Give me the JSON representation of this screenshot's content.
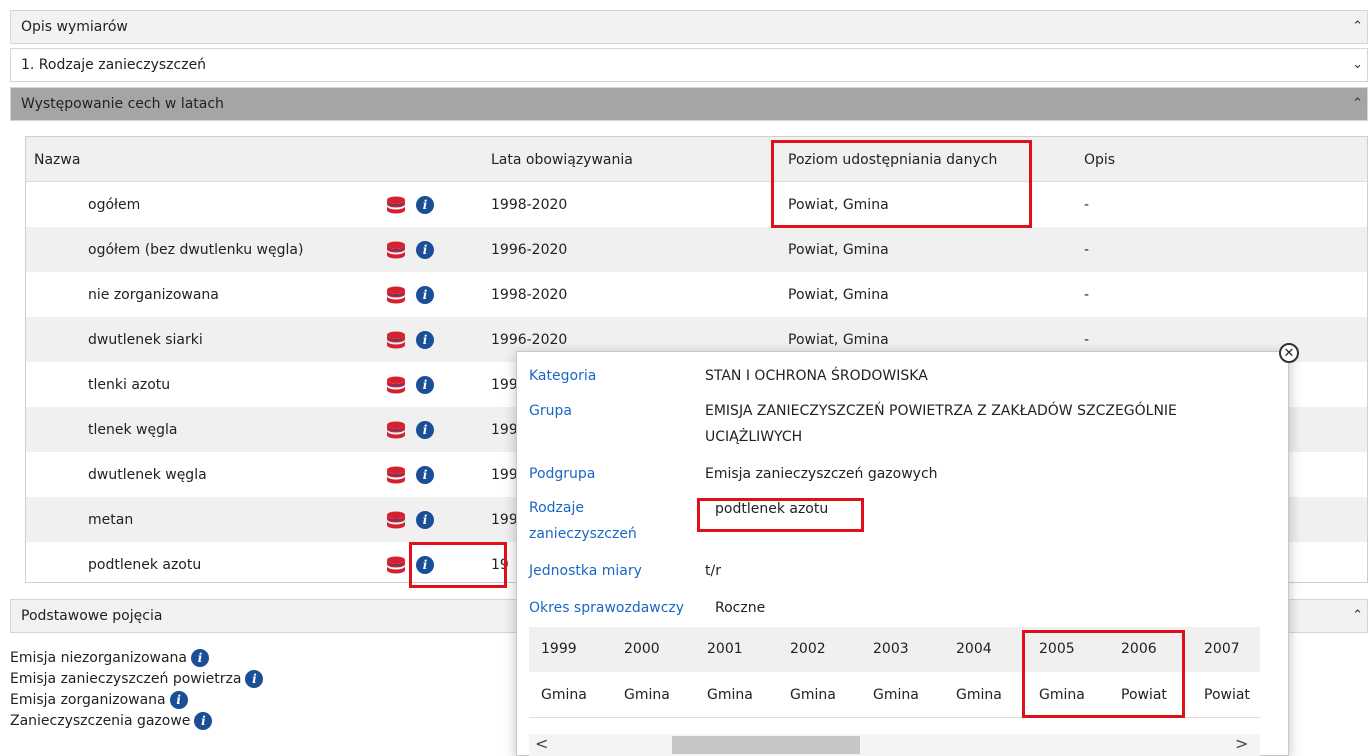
{
  "sections": {
    "dimensions_title": "Opis wymiarów",
    "dimension_item": "1. Rodzaje zanieczyszczeń",
    "years_title": "Występowanie cech w latach",
    "concepts_title": "Podstawowe pojęcia"
  },
  "table": {
    "headers": {
      "name": "Nazwa",
      "years": "Lata obowiązywania",
      "level": "Poziom udostępniania danych",
      "desc": "Opis"
    },
    "rows": [
      {
        "name": "ogółem",
        "years": "1998-2020",
        "level": "Powiat, Gmina",
        "desc": "-"
      },
      {
        "name": "ogółem (bez dwutlenku węgla)",
        "years": "1996-2020",
        "level": "Powiat, Gmina",
        "desc": "-"
      },
      {
        "name": "nie zorganizowana",
        "years": "1998-2020",
        "level": "Powiat, Gmina",
        "desc": "-"
      },
      {
        "name": "dwutlenek siarki",
        "years": "1996-2020",
        "level": "Powiat, Gmina",
        "desc": "-"
      },
      {
        "name": "tlenki azotu",
        "years": "199",
        "level": "",
        "desc": ""
      },
      {
        "name": "tlenek węgla",
        "years": "199",
        "level": "",
        "desc": ""
      },
      {
        "name": "dwutlenek węgla",
        "years": "199",
        "level": "",
        "desc": ""
      },
      {
        "name": "metan",
        "years": "199",
        "level": "",
        "desc": ""
      },
      {
        "name": "podtlenek azotu",
        "years": "19",
        "level": "",
        "desc": ""
      }
    ]
  },
  "popup": {
    "close": "✕",
    "category_label": "Kategoria",
    "category_value": "STAN I OCHRONA ŚRODOWISKA",
    "group_label": "Grupa",
    "group_value_line1": "EMISJA ZANIECZYSZCZEŃ POWIETRZA Z ZAKŁADÓW SZCZEGÓLNIE",
    "group_value_line2": "UCIĄŻLIWYCH",
    "subgroup_label": "Podgrupa",
    "subgroup_value": "Emisja zanieczyszczeń gazowych",
    "types_label_line1": "Rodzaje",
    "types_label_line2": "zanieczyszczeń",
    "types_value": "podtlenek azotu",
    "unit_label": "Jednostka miary",
    "unit_value": "t/r",
    "period_label": "Okres sprawozdawczy",
    "period_value": "Roczne",
    "years": [
      "1999",
      "2000",
      "2001",
      "2002",
      "2003",
      "2004",
      "2005",
      "2006",
      "2007"
    ],
    "levels": [
      "Gmina",
      "Gmina",
      "Gmina",
      "Gmina",
      "Gmina",
      "Gmina",
      "Gmina",
      "Powiat",
      "Powiat"
    ],
    "scroll_left": "<",
    "scroll_right": ">"
  },
  "concepts": [
    "Emisja niezorganizowana",
    "Emisja zanieczyszczeń powietrza",
    "Emisja zorganizowana",
    "Zanieczyszczenia gazowe"
  ],
  "icons": {
    "info": "i",
    "chevron_up": "⌃",
    "chevron_down": "⌄"
  },
  "colors": {
    "accent_blue": "#1a4f98",
    "link_blue": "#1a67c4",
    "highlight_red": "#e0101a",
    "db_red": "#d5202e"
  }
}
